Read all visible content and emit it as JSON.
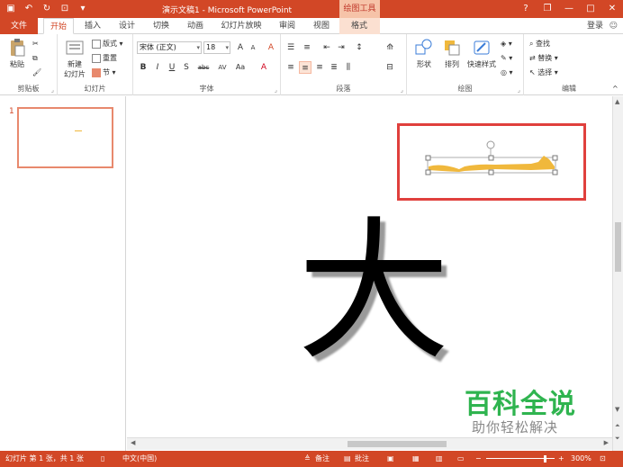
{
  "titlebar": {
    "title": "演示文稿1 - Microsoft PowerPoint",
    "context_tab_title": "绘图工具",
    "qat": [
      "save-icon",
      "undo-icon",
      "redo-icon",
      "present-icon",
      "customize-icon"
    ],
    "controls": {
      "help": "?",
      "restore": "❐",
      "minimize": "—",
      "maximize": "□",
      "close": "✕"
    }
  },
  "tabs": {
    "file": "文件",
    "home": "开始",
    "insert": "插入",
    "design": "设计",
    "transitions": "切换",
    "animations": "动画",
    "slideshow": "幻灯片放映",
    "review": "审阅",
    "view": "视图",
    "format": "格式",
    "login": "登录"
  },
  "ribbon": {
    "clipboard": {
      "label": "剪贴板",
      "paste": "粘贴"
    },
    "slides": {
      "label": "幻灯片",
      "new_slide": "新建",
      "new_slide2": "幻灯片",
      "layout": "版式",
      "reset": "重置",
      "section": "节"
    },
    "font": {
      "label": "字体",
      "font_name": "宋体 (正文)",
      "font_size": "18",
      "bold": "B",
      "italic": "I",
      "underline": "U",
      "shadow": "S",
      "strike": "abc",
      "spacing": "AV",
      "case": "Aa",
      "grow": "A",
      "shrink": "A",
      "clear": "A"
    },
    "paragraph": {
      "label": "段落"
    },
    "drawing": {
      "label": "绘图",
      "shapes": "形状",
      "arrange": "排列",
      "quick_styles": "快速样式"
    },
    "editing": {
      "label": "编辑",
      "find": "查找",
      "replace": "替换",
      "select": "选择"
    }
  },
  "slides_pane": {
    "slide_number": "1"
  },
  "slide": {
    "character": "大"
  },
  "watermark": {
    "main": "百科全说",
    "sub": "助你轻松解决"
  },
  "status": {
    "slide_info": "幻灯片 第 1 张，共 1 张",
    "language": "中文(中国)",
    "notes": "备注",
    "comments": "批注",
    "zoom": "300%",
    "zoom_minus": "−",
    "zoom_plus": "+"
  },
  "colors": {
    "accent": "#d24726",
    "highlight": "#e0403d",
    "shape_fill": "#f0b83c",
    "watermark": "#2fb44f"
  }
}
